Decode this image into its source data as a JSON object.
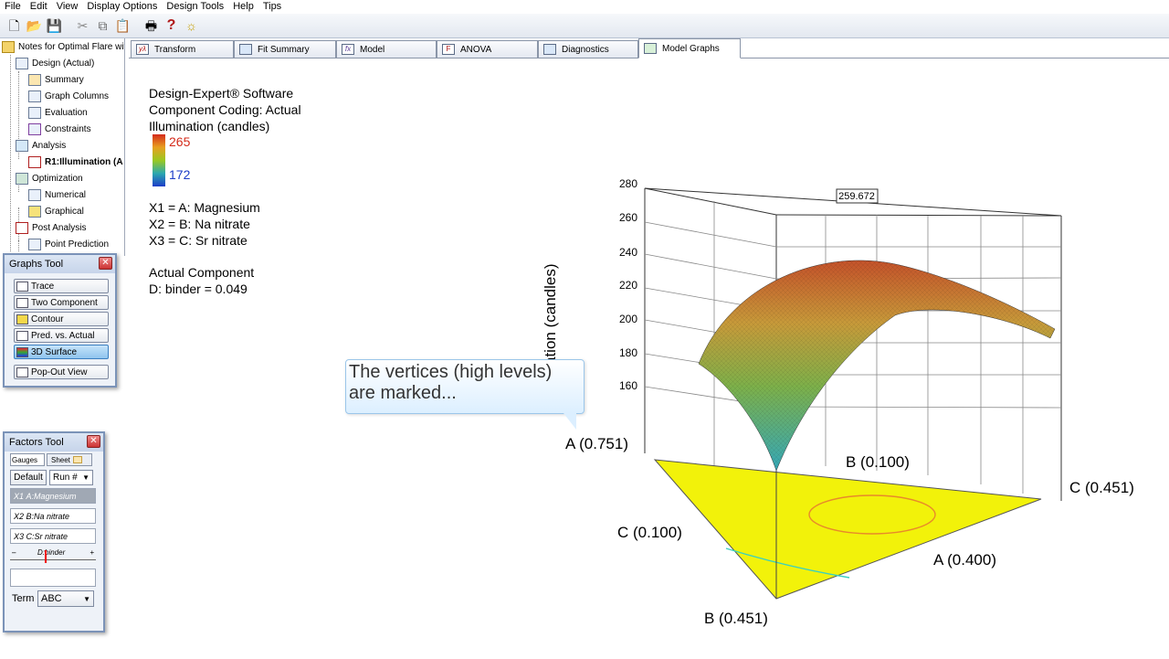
{
  "menu": [
    "File",
    "Edit",
    "View",
    "Display Options",
    "Design Tools",
    "Help",
    "Tips"
  ],
  "toolbar_icons": [
    "new-file-icon",
    "open-folder-icon",
    "save-icon",
    "cut-icon",
    "copy-icon",
    "paste-icon",
    "print-icon",
    "help-icon",
    "tip-bulb-icon"
  ],
  "tree": {
    "root": "Notes for Optimal Flare wit",
    "items": [
      {
        "label": "Design (Actual)",
        "level": 1
      },
      {
        "label": "Summary",
        "level": 2
      },
      {
        "label": "Graph Columns",
        "level": 2
      },
      {
        "label": "Evaluation",
        "level": 2
      },
      {
        "label": "Constraints",
        "level": 2
      },
      {
        "label": "Analysis",
        "level": 1
      },
      {
        "label": "R1:Illumination (A",
        "level": 2,
        "bold": true
      },
      {
        "label": "Optimization",
        "level": 1
      },
      {
        "label": "Numerical",
        "level": 2
      },
      {
        "label": "Graphical",
        "level": 2
      },
      {
        "label": "Post Analysis",
        "level": 1
      },
      {
        "label": "Point Prediction",
        "level": 2
      }
    ]
  },
  "graphs_tool": {
    "title": "Graphs Tool",
    "buttons": [
      "Trace",
      "Two Component",
      "Contour",
      "Pred. vs. Actual",
      "3D Surface",
      "Pop-Out View"
    ],
    "active": "3D Surface"
  },
  "factors_tool": {
    "title": "Factors Tool",
    "tab_gauges": "Gauges",
    "tab_sheet": "Sheet",
    "default_label": "Default",
    "run_label": "Run #",
    "factors": [
      {
        "id": "X1",
        "name": "A:Magnesium",
        "selected": true
      },
      {
        "id": "X2",
        "name": "B:Na nitrate"
      },
      {
        "id": "X3",
        "name": "C:Sr nitrate"
      }
    ],
    "slider_label": "D:binder",
    "term_label": "Term",
    "term_value": "ABC"
  },
  "tabs": [
    {
      "label": "Transform",
      "icon": "y-lambda-icon"
    },
    {
      "label": "Fit Summary",
      "icon": "table-icon"
    },
    {
      "label": "Model",
      "icon": "fx-icon"
    },
    {
      "label": "ANOVA",
      "icon": "anova-icon"
    },
    {
      "label": "Diagnostics",
      "icon": "chart-icon"
    },
    {
      "label": "Model Graphs",
      "icon": "graph-icon",
      "active": true
    }
  ],
  "info": {
    "line1": "Design-Expert® Software",
    "line2": "Component Coding: Actual",
    "line3": "Illumination (candles)",
    "legend_high": "265",
    "legend_low": "172",
    "x1": "X1 = A: Magnesium",
    "x2": "X2 = B: Na nitrate",
    "x3": "X3 = C: Sr nitrate",
    "actual_title": "Actual Component",
    "actual_value": "D: binder = 0.049"
  },
  "callout": {
    "line1": "The vertices (high levels)",
    "line2": "are marked..."
  },
  "chart_data": {
    "type": "3d-surface",
    "zlabel": "ation (candles)",
    "z_ticks": [
      160,
      180,
      200,
      220,
      240,
      260,
      280
    ],
    "annotation": "259.672",
    "vertex_labels": [
      "A (0.751)",
      "B (0.100)",
      "C (0.451)",
      "C (0.100)",
      "A (0.400)",
      "B (0.451)"
    ]
  }
}
